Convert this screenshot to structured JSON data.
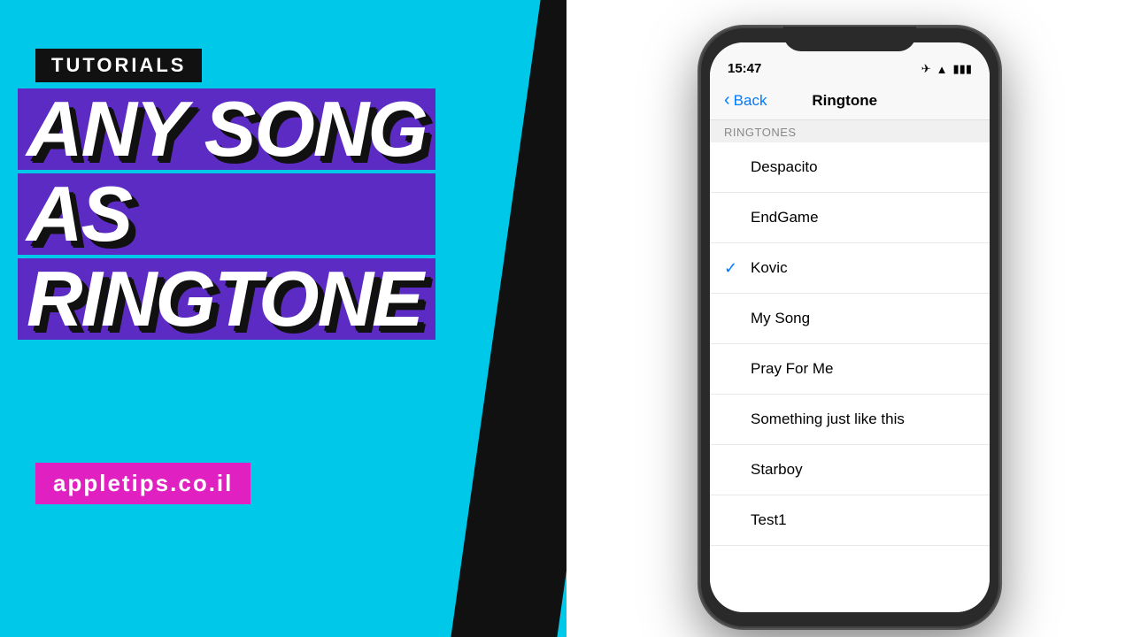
{
  "left": {
    "tutorials_label": "TUTORIALS",
    "title_line1": "ANY SONG",
    "title_line2": "AS",
    "title_line3": "RINGTONE",
    "website": "appletips.co.il"
  },
  "phone": {
    "status_time": "15:47",
    "nav_back_label": "Back",
    "nav_title": "Ringtone",
    "section_header": "RINGTONES",
    "ringtones": [
      {
        "name": "Despacito",
        "selected": false
      },
      {
        "name": "EndGame",
        "selected": false
      },
      {
        "name": "Kovic",
        "selected": true
      },
      {
        "name": "My Song",
        "selected": false
      },
      {
        "name": "Pray For Me",
        "selected": false
      },
      {
        "name": "Something just like this",
        "selected": false
      },
      {
        "name": "Starboy",
        "selected": false
      },
      {
        "name": "Test1",
        "selected": false
      }
    ]
  }
}
